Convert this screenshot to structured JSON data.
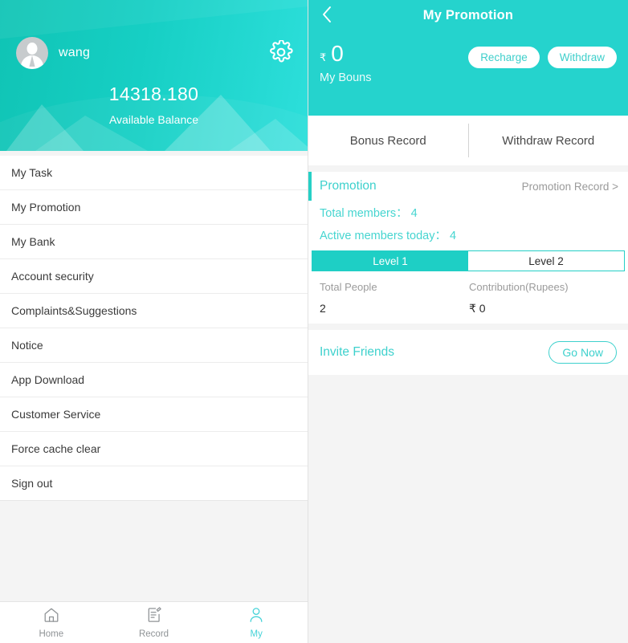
{
  "left": {
    "profile": {
      "avatar_icon": "user-avatar-icon",
      "username": "wang",
      "settings_icon": "gear-icon",
      "balance_amount": "14318.180",
      "balance_label": "Available Balance",
      "gradient_from": "#10c4b5",
      "gradient_to": "#2ddfdb"
    },
    "menu": [
      {
        "label": "My Task"
      },
      {
        "label": "My Promotion"
      },
      {
        "label": "My Bank"
      },
      {
        "label": "Account security"
      },
      {
        "label": "Complaints&Suggestions"
      },
      {
        "label": "Notice"
      },
      {
        "label": "App Download"
      },
      {
        "label": "Customer Service"
      },
      {
        "label": "Force cache clear"
      },
      {
        "label": "Sign out"
      }
    ],
    "bottom_nav": [
      {
        "label": "Home",
        "icon": "home-icon",
        "active": false
      },
      {
        "label": "Record",
        "icon": "document-edit-icon",
        "active": false
      },
      {
        "label": "My",
        "icon": "person-icon",
        "active": true
      }
    ],
    "nav_active_color": "#46d3d8"
  },
  "right": {
    "header": {
      "back_icon": "chevron-left-icon",
      "title": "My Promotion",
      "bonus_currency": "₹",
      "bonus_value": "0",
      "bonus_label": "My Bouns",
      "recharge_label": "Recharge",
      "withdraw_label": "Withdraw",
      "background": "#25d3cd"
    },
    "record_tabs": [
      {
        "label": "Bonus Record"
      },
      {
        "label": "Withdraw Record"
      }
    ],
    "promotion": {
      "section_label": "Promotion",
      "record_link": "Promotion Record >",
      "total_members": "Total members：  4",
      "active_members": "Active members today：  4",
      "accent_color": "#26d0c6",
      "levels": [
        {
          "label": "Level 1",
          "active": true
        },
        {
          "label": "Level 2",
          "active": false
        }
      ],
      "table": {
        "headers": [
          "Total People",
          "Contribution(Rupees)"
        ],
        "values": [
          "2",
          "₹ 0"
        ]
      }
    },
    "invite": {
      "label": "Invite Friends",
      "button_label": "Go Now"
    }
  }
}
